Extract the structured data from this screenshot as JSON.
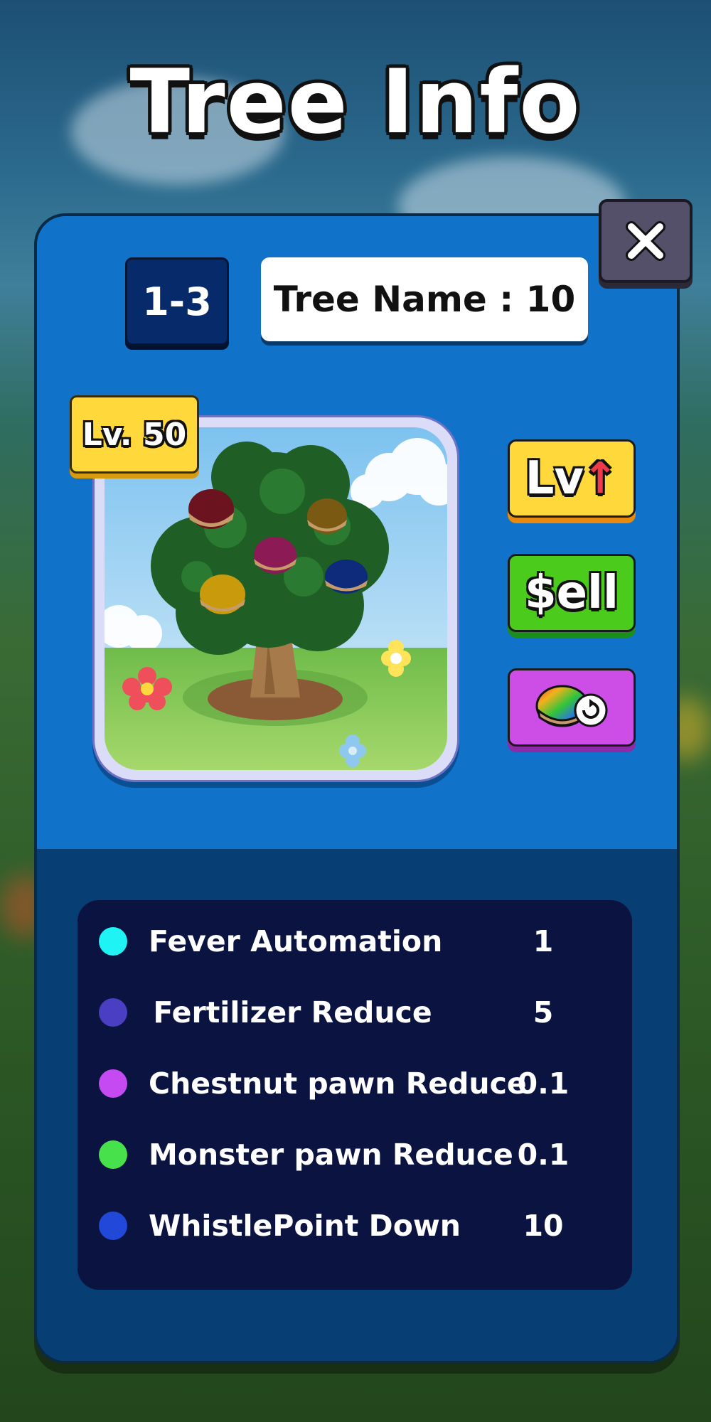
{
  "title": "Tree Info",
  "tree": {
    "stage": "1-3",
    "name": "Tree Name : 10",
    "level": "Lv. 50"
  },
  "buttons": {
    "close_icon": "close-icon",
    "level_up_label": "Lv",
    "level_up_icon": "up-arrow-icon",
    "sell_label": "$ell",
    "change_icon": "chestnut-refresh-icon"
  },
  "stats": [
    {
      "label": "Fever Automation",
      "value": "1",
      "color": "#1ff3f3"
    },
    {
      "label": "Fertilizer Reduce",
      "value": "5",
      "color": "#4a3fc2"
    },
    {
      "label": "Chestnut pawn Reduce",
      "value": "0.1",
      "color": "#c54af1"
    },
    {
      "label": "Monster pawn Reduce",
      "value": "0.1",
      "color": "#47e24b"
    },
    {
      "label": "WhistlePoint Down",
      "value": "10",
      "color": "#2148d8"
    }
  ]
}
